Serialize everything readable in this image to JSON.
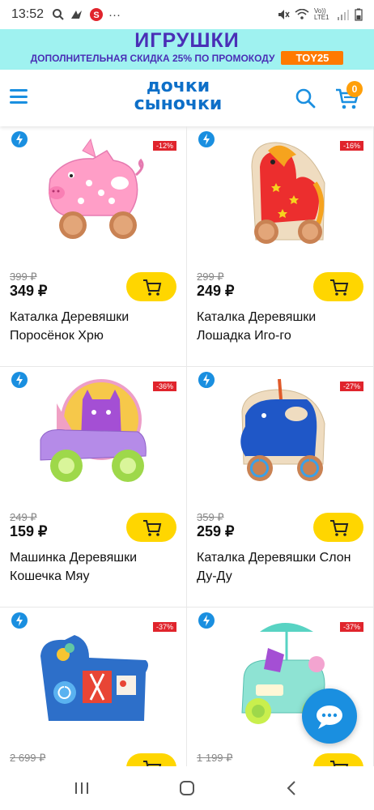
{
  "status": {
    "time": "13:52",
    "more": "···",
    "net_label": "Vo)) LTE1"
  },
  "promo": {
    "title": "ИГРУШКИ",
    "subtitle": "ДОПОЛНИТЕЛЬНАЯ СКИДКА 25% ПО ПРОМОКОДУ",
    "code": "TOY25"
  },
  "header": {
    "logo_line1": "дочки",
    "logo_line2": "сыночки",
    "cart_count": "0"
  },
  "products": [
    {
      "discount": "-12%",
      "old_price": "399 ₽",
      "price": "349 ₽",
      "name": "Каталка Деревяшки Поросёнок Хрю"
    },
    {
      "discount": "-16%",
      "old_price": "299 ₽",
      "price": "249 ₽",
      "name": "Каталка Деревяшки Лошадка Иго-го"
    },
    {
      "discount": "-36%",
      "old_price": "249 ₽",
      "price": "159 ₽",
      "name": "Машинка Деревяшки Кошечка Мяу"
    },
    {
      "discount": "-27%",
      "old_price": "359 ₽",
      "price": "259 ₽",
      "name": "Каталка Деревяшки Слон Ду-Ду"
    },
    {
      "discount": "-37%",
      "old_price": "2 699 ₽",
      "price": "",
      "name": ""
    },
    {
      "discount": "-37%",
      "old_price": "1 199 ₽",
      "price": "",
      "name": ""
    }
  ],
  "colors": {
    "accent": "#1a8fe0",
    "banner_bg": "#9ff2f0",
    "cart_button": "#ffd600",
    "discount_badge": "#e0242c",
    "promo_code_bg": "#ff7a00"
  }
}
